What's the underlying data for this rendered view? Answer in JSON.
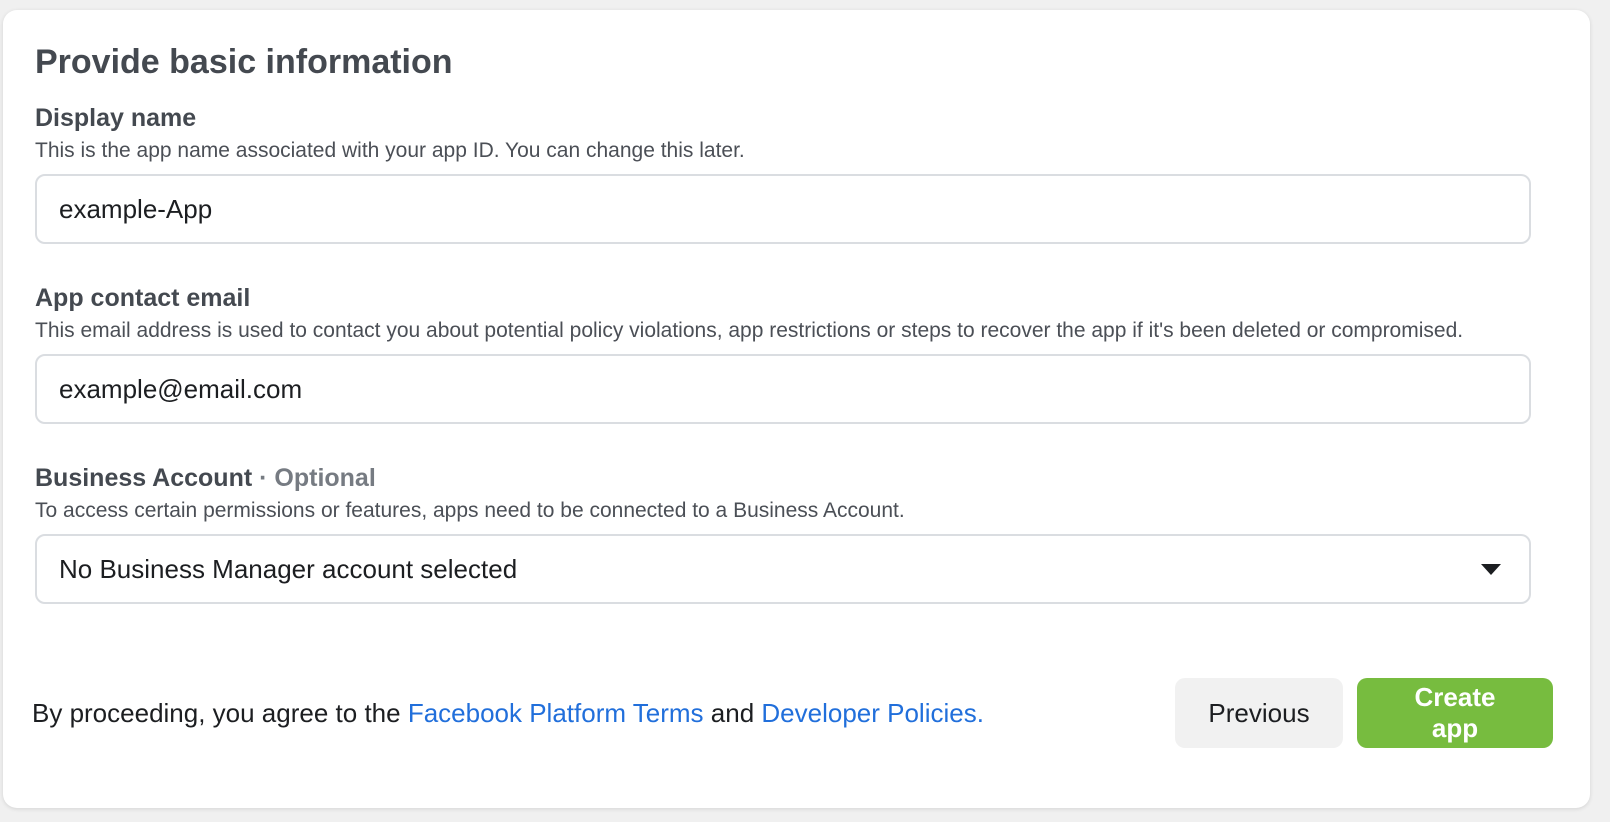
{
  "page": {
    "title": "Provide basic information"
  },
  "display_name": {
    "label": "Display name",
    "description": "This is the app name associated with your app ID. You can change this later.",
    "value": "example-App"
  },
  "contact_email": {
    "label": "App contact email",
    "description": "This email address is used to contact you about potential policy violations, app restrictions or steps to recover the app if it's been deleted or compromised.",
    "value": "example@email.com"
  },
  "business_account": {
    "label": "Business Account",
    "optional": " · Optional",
    "description": "To access certain permissions or features, apps need to be connected to a Business Account.",
    "selected": "No Business Manager account selected",
    "icon": "caret-down-icon"
  },
  "footer": {
    "agree_prefix": "By proceeding, you agree to the ",
    "terms_link": "Facebook Platform Terms",
    "agree_middle": " and ",
    "policies_link": "Developer Policies.",
    "previous_label": "Previous",
    "create_label": "Create app"
  },
  "colors": {
    "link": "#216fdb",
    "primary_button": "#77bc3f",
    "secondary_button": "#f1f1f1"
  }
}
